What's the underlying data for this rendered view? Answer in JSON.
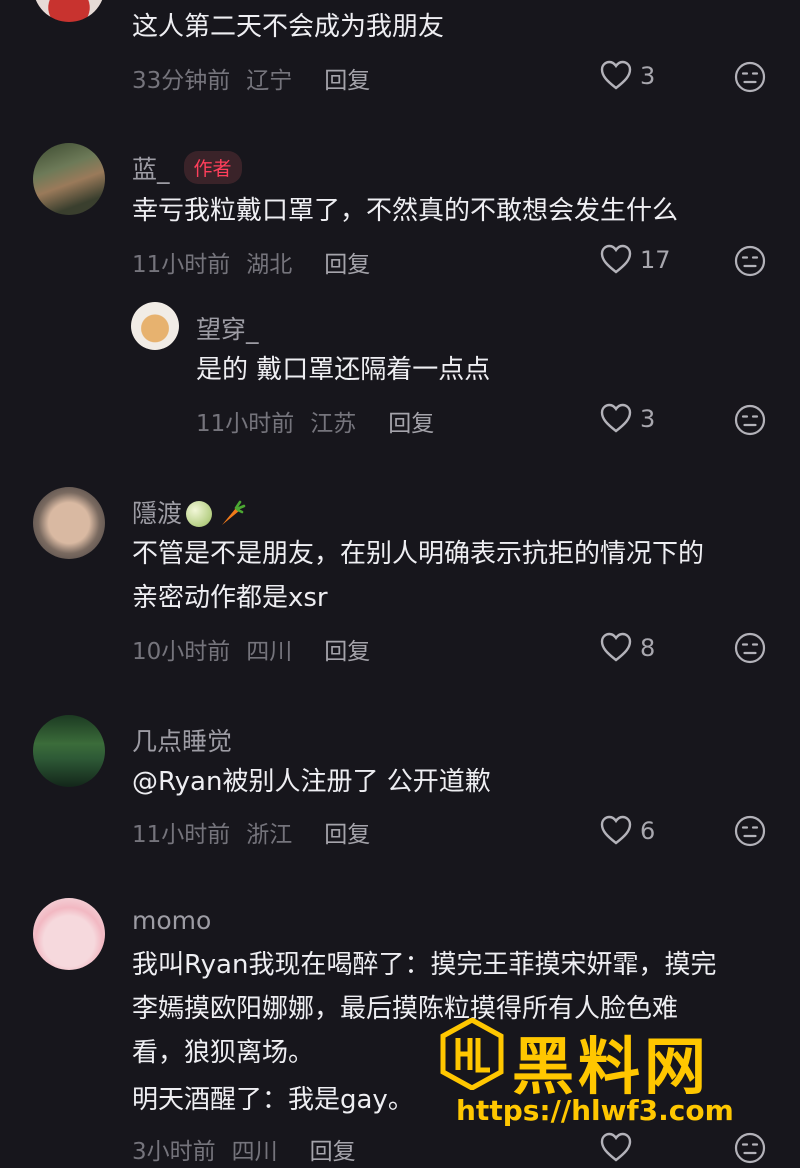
{
  "comments": [
    {
      "text": [
        "这人第二天不会成为我朋友"
      ],
      "time": "33分钟前",
      "location": "辽宁",
      "reply_label": "回复",
      "likes": "3"
    },
    {
      "name": "蓝_",
      "author_tag": "作者",
      "text": [
        "幸亏我粒戴口罩了，不然真的不敢想会发生什么"
      ],
      "time": "11小时前",
      "location": "湖北",
      "reply_label": "回复",
      "likes": "17"
    },
    {
      "name": "望穿_",
      "text": [
        "是的 戴口罩还隔着一点点"
      ],
      "time": "11小时前",
      "location": "江苏",
      "reply_label": "回复",
      "likes": "3"
    },
    {
      "name": "隱渡",
      "name_emojis": [
        "melon-emoji",
        "carrot-emoji"
      ],
      "text": [
        "不管是不是朋友，在别人明确表示抗拒的情况下的",
        "亲密动作都是xsr"
      ],
      "time": "10小时前",
      "location": "四川",
      "reply_label": "回复",
      "likes": "8"
    },
    {
      "name": "几点睡觉",
      "text": [
        "@Ryan被别人注册了 公开道歉"
      ],
      "time": "11小时前",
      "location": "浙江",
      "reply_label": "回复",
      "likes": "6"
    },
    {
      "name": "momo",
      "text": [
        "我叫Ryan我现在喝醉了：摸完王菲摸宋妍霏，摸完",
        "李嫣摸欧阳娜娜，最后摸陈粒摸得所有人脸色难",
        "看，狼狈离场。",
        "明天酒醒了：我是gay。"
      ],
      "time": "3小时前",
      "location": "四川",
      "reply_label": "回复",
      "likes": ""
    }
  ],
  "watermark": {
    "title": "黑料网",
    "url": "https://hlwf3.com"
  },
  "colors": {
    "background": "#17161c",
    "author_tag": "#ff3f5b",
    "watermark": "#ffc700"
  },
  "icons": {
    "like": "heart-outline-icon",
    "dislike": "neutral-face-icon"
  }
}
